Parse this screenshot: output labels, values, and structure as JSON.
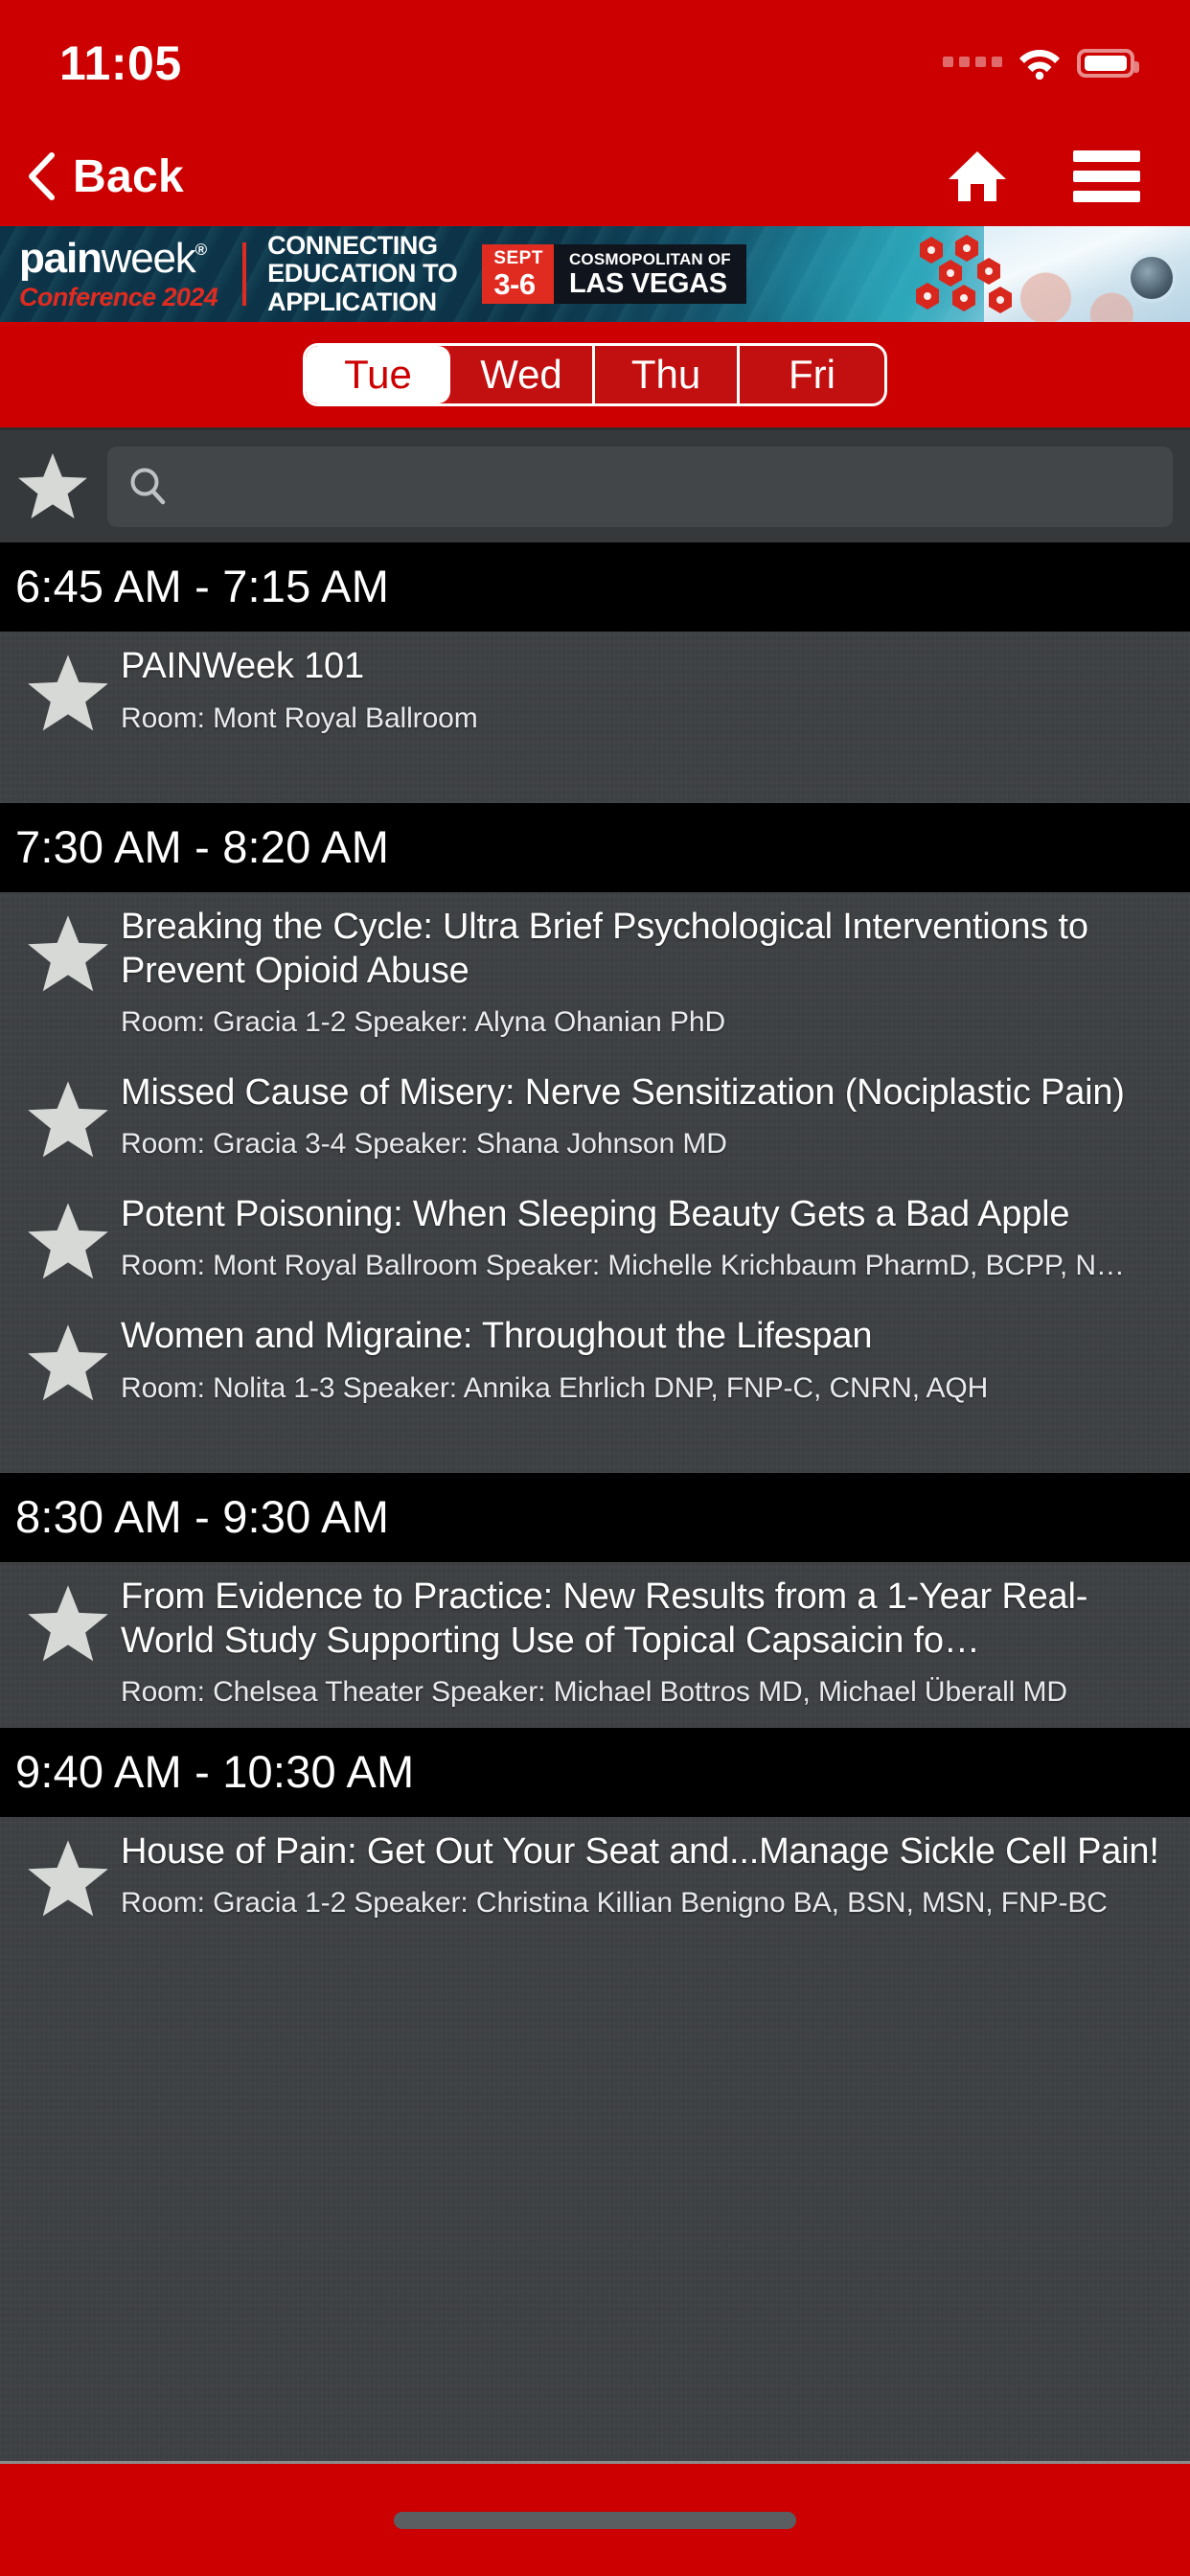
{
  "status_bar": {
    "time": "11:05",
    "signal_icon": "signal-dots-icon",
    "wifi_icon": "wifi-icon",
    "battery_icon": "battery-icon"
  },
  "nav_bar": {
    "back_label": "Back",
    "back_chevron_icon": "chevron-left-icon",
    "home_icon": "home-icon",
    "menu_icon": "hamburger-menu-icon"
  },
  "banner": {
    "logo_pain": "pain",
    "logo_week": "week",
    "logo_registered": "®",
    "logo_subtitle": "Conference 2024",
    "tagline_line1": "CONNECTING",
    "tagline_line2": "EDUCATION TO",
    "tagline_line3": "APPLICATION",
    "date_month": "SEPT",
    "date_days": "3-6",
    "venue_line1": "COSMOPOLITAN OF",
    "venue_line2": "LAS VEGAS",
    "photo_description": "clinician-with-tablet-photo",
    "accent_red": "#E02B20",
    "banner_navy": "#0D3449"
  },
  "day_tabs": {
    "selected": "Tue",
    "items": [
      {
        "label": "Tue",
        "active": true
      },
      {
        "label": "Wed",
        "active": false
      },
      {
        "label": "Thu",
        "active": false
      },
      {
        "label": "Fri",
        "active": false
      }
    ]
  },
  "search": {
    "favorites_filter_icon": "star-icon",
    "search_icon": "search-icon",
    "value": "",
    "placeholder": ""
  },
  "theme": {
    "header_red": "#CC0000",
    "list_background": "#3E4144",
    "time_header_background": "#000000",
    "star_color": "#D7D9D6"
  },
  "schedule": [
    {
      "time": "6:45 AM - 7:15 AM",
      "sessions": [
        {
          "title": "PAINWeek 101",
          "meta": "Room: Mont Royal Ballroom",
          "favorited": false
        }
      ]
    },
    {
      "time": "7:30 AM - 8:20 AM",
      "sessions": [
        {
          "title": "Breaking the Cycle: Ultra Brief Psychological Interventions to Prevent Opioid Abuse",
          "meta": "Room: Gracia 1-2 Speaker: Alyna Ohanian PhD",
          "favorited": false
        },
        {
          "title": "Missed Cause of Misery: Nerve Sensitization (Nociplastic Pain)",
          "meta": "Room: Gracia 3-4 Speaker: Shana Johnson MD",
          "favorited": false
        },
        {
          "title": "Potent Poisoning: When Sleeping Beauty Gets a Bad Apple",
          "meta": "Room: Mont Royal Ballroom Speaker: Michelle Krichbaum PharmD, BCPP, N…",
          "favorited": false
        },
        {
          "title": "Women and Migraine: Throughout the Lifespan",
          "meta": "Room: Nolita 1-3 Speaker: Annika Ehrlich DNP, FNP-C, CNRN, AQH",
          "favorited": false
        }
      ]
    },
    {
      "time": "8:30 AM - 9:30 AM",
      "sessions": [
        {
          "title": "From Evidence to Practice: New Results from a 1-Year Real-World Study Supporting Use of Topical Capsaicin fo…",
          "meta": "Room: Chelsea Theater Speaker: Michael Bottros MD, Michael Überall MD",
          "favorited": false
        }
      ]
    },
    {
      "time": "9:40 AM - 10:30 AM",
      "sessions": [
        {
          "title": "House of Pain: Get Out Your Seat and...Manage Sickle Cell Pain!",
          "meta": "Room: Gracia 1-2 Speaker: Christina Killian Benigno BA, BSN, MSN, FNP-BC",
          "favorited": false
        }
      ]
    }
  ],
  "home_indicator": "home-indicator-pill"
}
